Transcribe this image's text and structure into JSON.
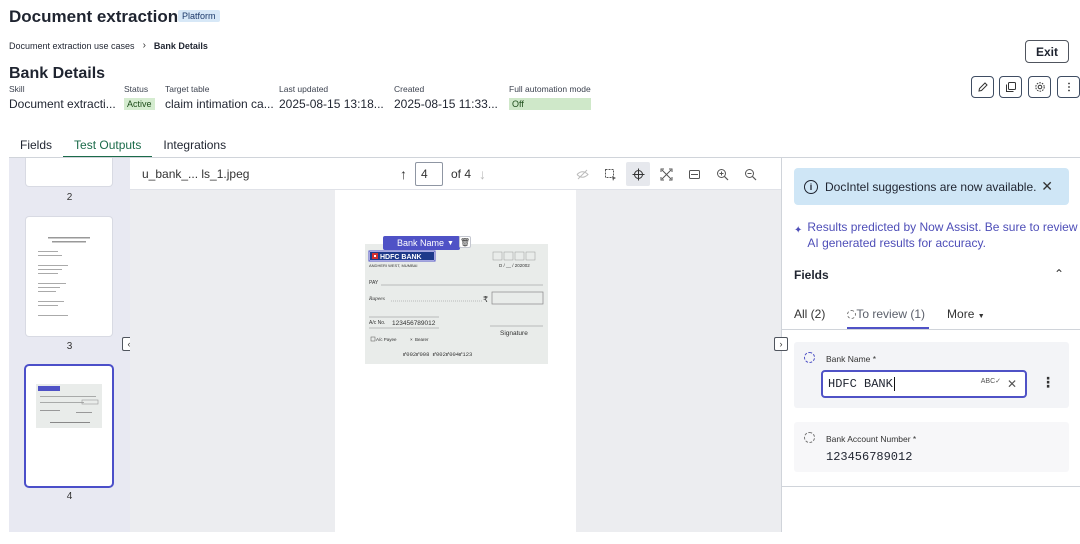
{
  "header": {
    "app_title": "Document extraction",
    "badge": "Platform",
    "breadcrumb": [
      "Document extraction use cases",
      "Bank Details"
    ],
    "exit_label": "Exit",
    "page_title": "Bank Details"
  },
  "meta": {
    "skill": {
      "label": "Skill",
      "value": "Document extracti..."
    },
    "status": {
      "label": "Status",
      "value": "Active"
    },
    "target_table": {
      "label": "Target table",
      "value": "claim intimation ca..."
    },
    "last_updated": {
      "label": "Last updated",
      "value": "2025-08-15 13:18..."
    },
    "created": {
      "label": "Created",
      "value": "2025-08-15 11:33..."
    },
    "automation": {
      "label": "Full automation mode",
      "value": "Off"
    }
  },
  "header_actions": [
    "edit-icon",
    "copy-icon",
    "gear-icon",
    "more-vertical-icon"
  ],
  "tabs": [
    {
      "label": "Fields",
      "active": false
    },
    {
      "label": "Test Outputs",
      "active": true
    },
    {
      "label": "Integrations",
      "active": false
    }
  ],
  "thumbnails": [
    {
      "page": "2",
      "selected": false
    },
    {
      "page": "3",
      "selected": false
    },
    {
      "page": "4",
      "selected": true
    }
  ],
  "viewer": {
    "file_name": "u_bank_... ls_1.jpeg",
    "current_page": "4",
    "total_pages": "of 4",
    "tools": [
      "hide-icon",
      "select-region-icon",
      "crosshair-icon",
      "fit-screen-icon",
      "fit-width-icon",
      "zoom-in-icon",
      "zoom-out-icon"
    ],
    "active_tool": "crosshair-icon"
  },
  "cheque": {
    "tag_label": "Bank Name",
    "bank_name": "HDFC BANK",
    "branch": "ANDHERI WEST, MUMBAI",
    "date": "D / __ / 202002",
    "pay": "PAY",
    "rupees": "Rupees",
    "account_label": "A/c No.",
    "account_number": "123456789012",
    "signature": "Signature",
    "payee": "A/c Payee",
    "bearer": "Bearer",
    "micr": "⑈002⑈008  ⑈002⑈004⑈123"
  },
  "right_panel": {
    "banner_text": "DocIntel suggestions are now available.",
    "assist_note": "Results predicted by Now Assist. Be sure to review AI generated results for accuracy.",
    "fields_heading": "Fields",
    "filter_tabs": [
      {
        "label": "All (2)",
        "active": false
      },
      {
        "label": "To review (1)",
        "active": true
      },
      {
        "label": "More",
        "active": false
      }
    ],
    "fields": [
      {
        "label": "Bank Name *",
        "value": "HDFC BANK",
        "editing": true
      },
      {
        "label": "Bank Account Number *",
        "value": "123456789012",
        "editing": false
      }
    ]
  }
}
